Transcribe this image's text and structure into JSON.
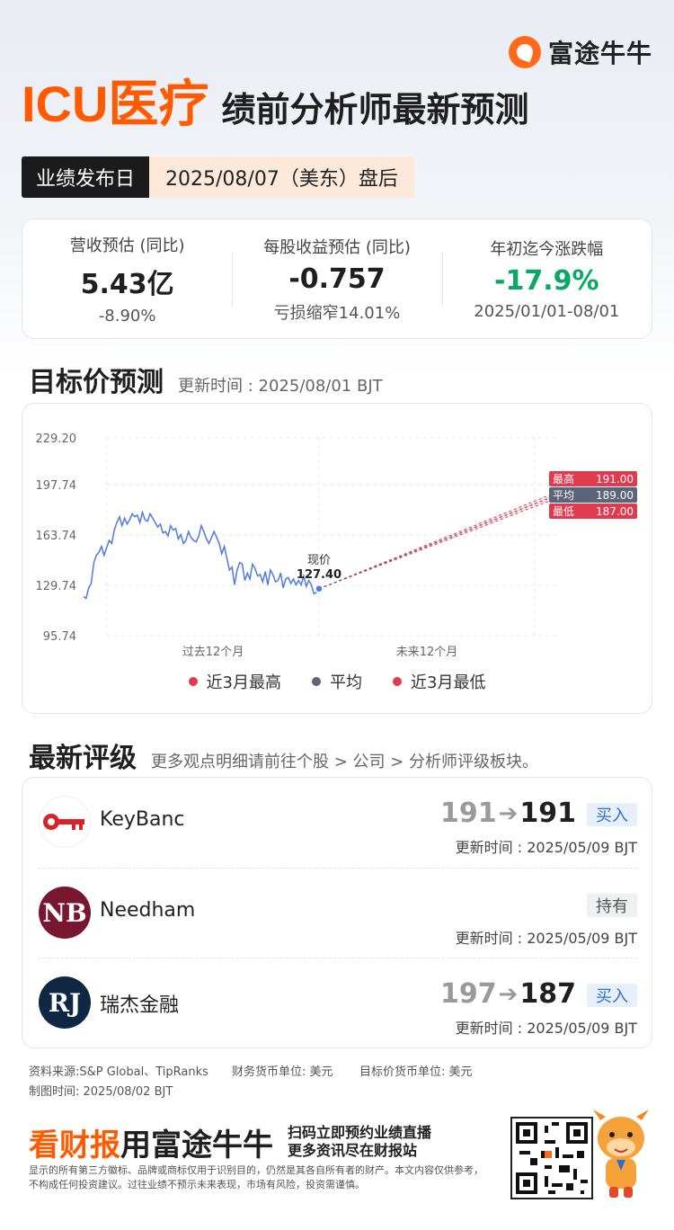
{
  "brand": {
    "name": "富途牛牛"
  },
  "title": {
    "main": "ICU医疗",
    "sub": "绩前分析师最新预测"
  },
  "release": {
    "label": "业绩发布日",
    "value": "2025/08/07（美东）盘后"
  },
  "stats": [
    {
      "label": "营收预估 (同比)",
      "value": "5.43亿",
      "sub": "-8.90%"
    },
    {
      "label": "每股收益预估 (同比)",
      "value": "-0.757",
      "sub": "亏损缩窄14.01%"
    },
    {
      "label": "年初迄今涨跌幅",
      "value": "-17.9%",
      "sub": "2025/01/01-08/01"
    }
  ],
  "target_section": {
    "title": "目标价预测",
    "updated": "更新时间 : 2025/08/01 BJT"
  },
  "chart_data": {
    "type": "line",
    "y_ticks": [
      "229.20",
      "197.74",
      "163.74",
      "129.74",
      "95.74"
    ],
    "ylim": [
      95.74,
      229.2
    ],
    "x_labels": [
      "过去12个月",
      "未来12个月"
    ],
    "current": {
      "label": "现价",
      "value": "127.40"
    },
    "history": [
      122,
      121,
      128,
      131,
      145,
      150,
      152,
      156,
      150,
      155,
      160,
      158,
      167,
      172,
      176,
      170,
      175,
      171,
      174,
      178,
      176,
      177,
      172,
      179,
      174,
      173,
      178,
      175,
      172,
      169,
      171,
      165,
      166,
      163,
      170,
      167,
      168,
      161,
      164,
      158,
      160,
      166,
      162,
      160,
      159,
      163,
      170,
      166,
      161,
      158,
      162,
      166,
      162,
      158,
      151,
      156,
      148,
      140,
      142,
      130,
      140,
      145,
      144,
      133,
      138,
      134,
      144,
      141,
      136,
      137,
      132,
      139,
      130,
      140,
      137,
      132,
      133,
      138,
      128,
      134,
      135,
      131,
      134,
      130,
      133,
      130,
      136,
      129,
      133,
      130,
      124,
      125,
      127.4
    ],
    "forecast": {
      "high": 191.0,
      "avg": 189.0,
      "low": 187.0
    },
    "forecast_labels": [
      {
        "name": "最高",
        "value": "191.00",
        "color": "#e03a4e"
      },
      {
        "name": "平均",
        "value": "189.00",
        "color": "#5b6478"
      },
      {
        "name": "最低",
        "value": "187.00",
        "color": "#e03a4e"
      }
    ],
    "legend": [
      {
        "label": "近3月最高",
        "color": "#e23a4b"
      },
      {
        "label": "平均",
        "color": "#5b6478"
      },
      {
        "label": "近3月最低",
        "color": "#e23a4b"
      }
    ]
  },
  "ratings_section": {
    "title": "最新评级",
    "hint": "更多观点明细请前往个股 > 公司 > 分析师评级板块。"
  },
  "ratings": [
    {
      "firm": "KeyBanc",
      "from": "191",
      "to": "191",
      "rating": "买入",
      "updated": "更新时间 : 2025/05/09 BJT"
    },
    {
      "firm": "Needham",
      "from": "",
      "to": "",
      "rating": "持有",
      "updated": "更新时间 : 2025/05/09 BJT"
    },
    {
      "firm": "瑞杰金融",
      "from": "197",
      "to": "187",
      "rating": "买入",
      "updated": "更新时间 : 2025/05/09 BJT"
    }
  ],
  "footer": {
    "source": "资料来源:S&P Global、TipRanks",
    "currency1": "财务货币单位: 美元",
    "currency2": "目标价货币单位: 美元",
    "made": "制图时间: 2025/08/02 BJT"
  },
  "banner": {
    "promo_orange": "看财报",
    "promo_black": "用富途牛牛",
    "line1": "扫码立即预约业绩直播",
    "line2": "更多资讯尽在财报站",
    "disclaimer": "显示的所有第三方徽标、品牌或商标仅用于识别目的，仍然是其各自所有者的财产。本文内容仅供参考，不构成任何投资建议。过往业绩不预示未来表现，市场有风险，投资需谨慎。"
  }
}
